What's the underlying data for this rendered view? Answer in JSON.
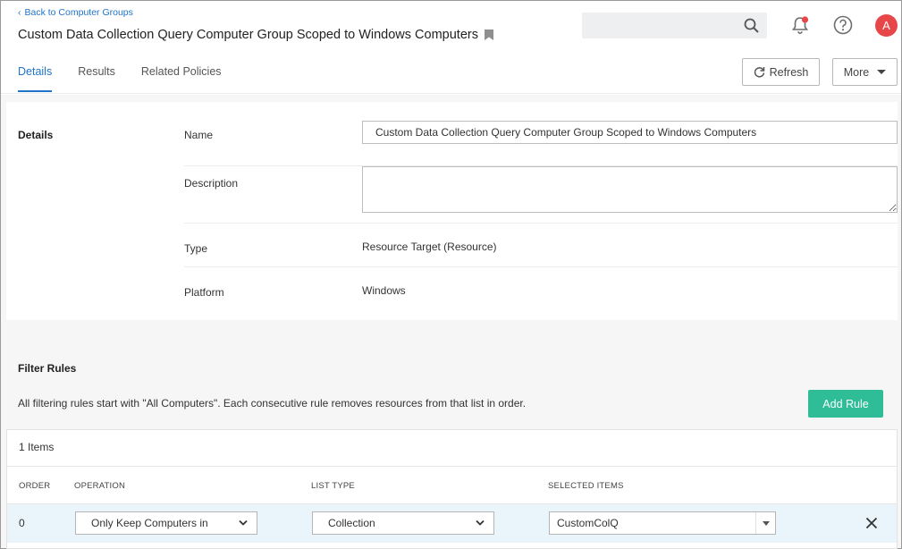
{
  "header": {
    "back_link": "Back to Computer Groups",
    "title": "Custom Data Collection Query Computer Group Scoped to Windows Computers",
    "search_placeholder": "",
    "avatar_letter": "A"
  },
  "tabs": [
    {
      "label": "Details",
      "active": true
    },
    {
      "label": "Results",
      "active": false
    },
    {
      "label": "Related Policies",
      "active": false
    }
  ],
  "toolbar": {
    "refresh_label": "Refresh",
    "more_label": "More"
  },
  "details": {
    "section_label": "Details",
    "name_label": "Name",
    "name_value": "Custom Data Collection Query Computer Group Scoped to Windows Computers",
    "description_label": "Description",
    "description_value": "",
    "type_label": "Type",
    "type_value": "Resource Target (Resource)",
    "platform_label": "Platform",
    "platform_value": "Windows"
  },
  "filter_rules": {
    "section_label": "Filter Rules",
    "description": "All filtering rules start with \"All Computers\". Each consecutive rule removes resources from that list in order.",
    "add_rule_label": "Add Rule",
    "items_count": "1 Items",
    "columns": [
      "ORDER",
      "OPERATION",
      "LIST TYPE",
      "SELECTED ITEMS"
    ],
    "rows": [
      {
        "order": "0",
        "operation": "Only Keep Computers in",
        "list_type": "Collection",
        "selected_items": "CustomColQ"
      }
    ]
  },
  "colors": {
    "accent": "#1f74c7",
    "add_rule": "#2ebd97",
    "avatar": "#e8474a",
    "notification_dot": "#e8474a",
    "row_highlight": "#eaf5fb"
  }
}
